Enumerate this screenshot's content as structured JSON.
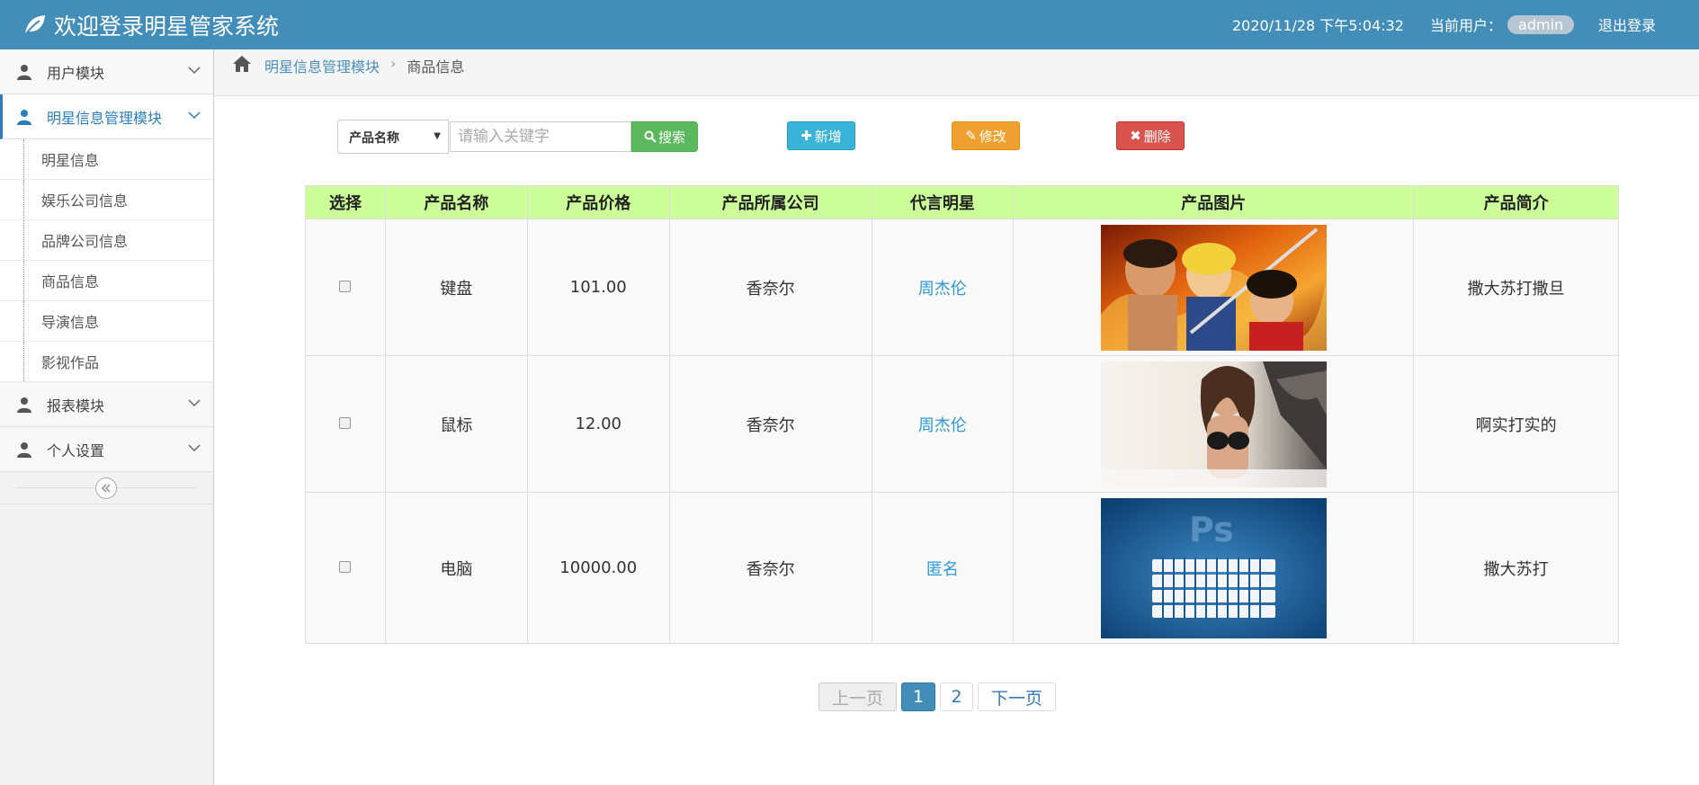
{
  "header": {
    "title": "欢迎登录明星管家系统",
    "datetime": "2020/11/28 下午5:04:32",
    "user_label": "当前用户：",
    "username": "admin",
    "logout": "退出登录",
    "brand_color": "#438eb9"
  },
  "sidebar": {
    "groups": [
      {
        "label": "用户模块",
        "icon": "user-icon"
      },
      {
        "label": "明星信息管理模块",
        "icon": "user-icon",
        "active": true
      },
      {
        "label": "报表模块",
        "icon": "user-icon"
      },
      {
        "label": "个人设置",
        "icon": "user-icon"
      }
    ],
    "sub_items": [
      {
        "label": "明星信息"
      },
      {
        "label": "娱乐公司信息"
      },
      {
        "label": "品牌公司信息"
      },
      {
        "label": "商品信息"
      },
      {
        "label": "导演信息"
      },
      {
        "label": "影视作品"
      }
    ]
  },
  "breadcrumb": {
    "parent": "明星信息管理模块",
    "current": "商品信息"
  },
  "toolbar": {
    "select_value": "产品名称",
    "keyword_placeholder": "请输入关键字",
    "search": "搜索",
    "add": "新增",
    "edit": "修改",
    "delete": "删除"
  },
  "table": {
    "headers": [
      "选择",
      "产品名称",
      "产品价格",
      "产品所属公司",
      "代言明星",
      "产品图片",
      "产品简介"
    ],
    "rows": [
      {
        "name": "键盘",
        "price": "101.00",
        "company": "香奈尔",
        "star": "周杰伦",
        "intro": "撒大苏打撒旦",
        "image": "anime-heroes-image"
      },
      {
        "name": "鼠标",
        "price": "12.00",
        "company": "香奈尔",
        "star": "周杰伦",
        "intro": "啊实打实的",
        "image": "bikini-model-image"
      },
      {
        "name": "电脑",
        "price": "10000.00",
        "company": "香奈尔",
        "star": "匿名",
        "intro": "撒大苏打",
        "image": "photoshop-keyboard-image"
      }
    ]
  },
  "pagination": {
    "prev": "上一页",
    "pages": [
      "1",
      "2"
    ],
    "current": "1",
    "next": "下一页"
  }
}
